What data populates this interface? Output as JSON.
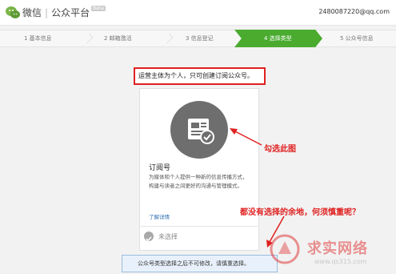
{
  "header": {
    "app_name": "微信",
    "separator": "|",
    "platform_name": "公众平台",
    "beta": "Beta",
    "email": "2480087220@qq.com"
  },
  "steps": [
    {
      "label": "1 基本信息",
      "active": false
    },
    {
      "label": "2 邮箱激活",
      "active": false
    },
    {
      "label": "3 信息登记",
      "active": false
    },
    {
      "label": "4 选择类型",
      "active": true
    },
    {
      "label": "5 公众号信息",
      "active": false
    }
  ],
  "notice": "运营主体为个人，只可创建订阅公众号。",
  "card": {
    "title": "订阅号",
    "description": "为媒体和个人提供一种新的信息传播方式，构建与读者之间更好的沟通与管理模式。",
    "link": "了解详情",
    "status": "未选择"
  },
  "bottom_notice": "公众号类型选择之后不可修改，请慎重选择。",
  "annotations": {
    "check_this": "勾选此图",
    "no_choice": "都没有选择的余地，何须慎重呢？"
  },
  "watermark": {
    "text": "求实网络",
    "url": "www.qs315.com"
  },
  "colors": {
    "accent_green": "#4aab2f",
    "annotation_red": "#e02020",
    "link_blue": "#2f6fb6"
  }
}
